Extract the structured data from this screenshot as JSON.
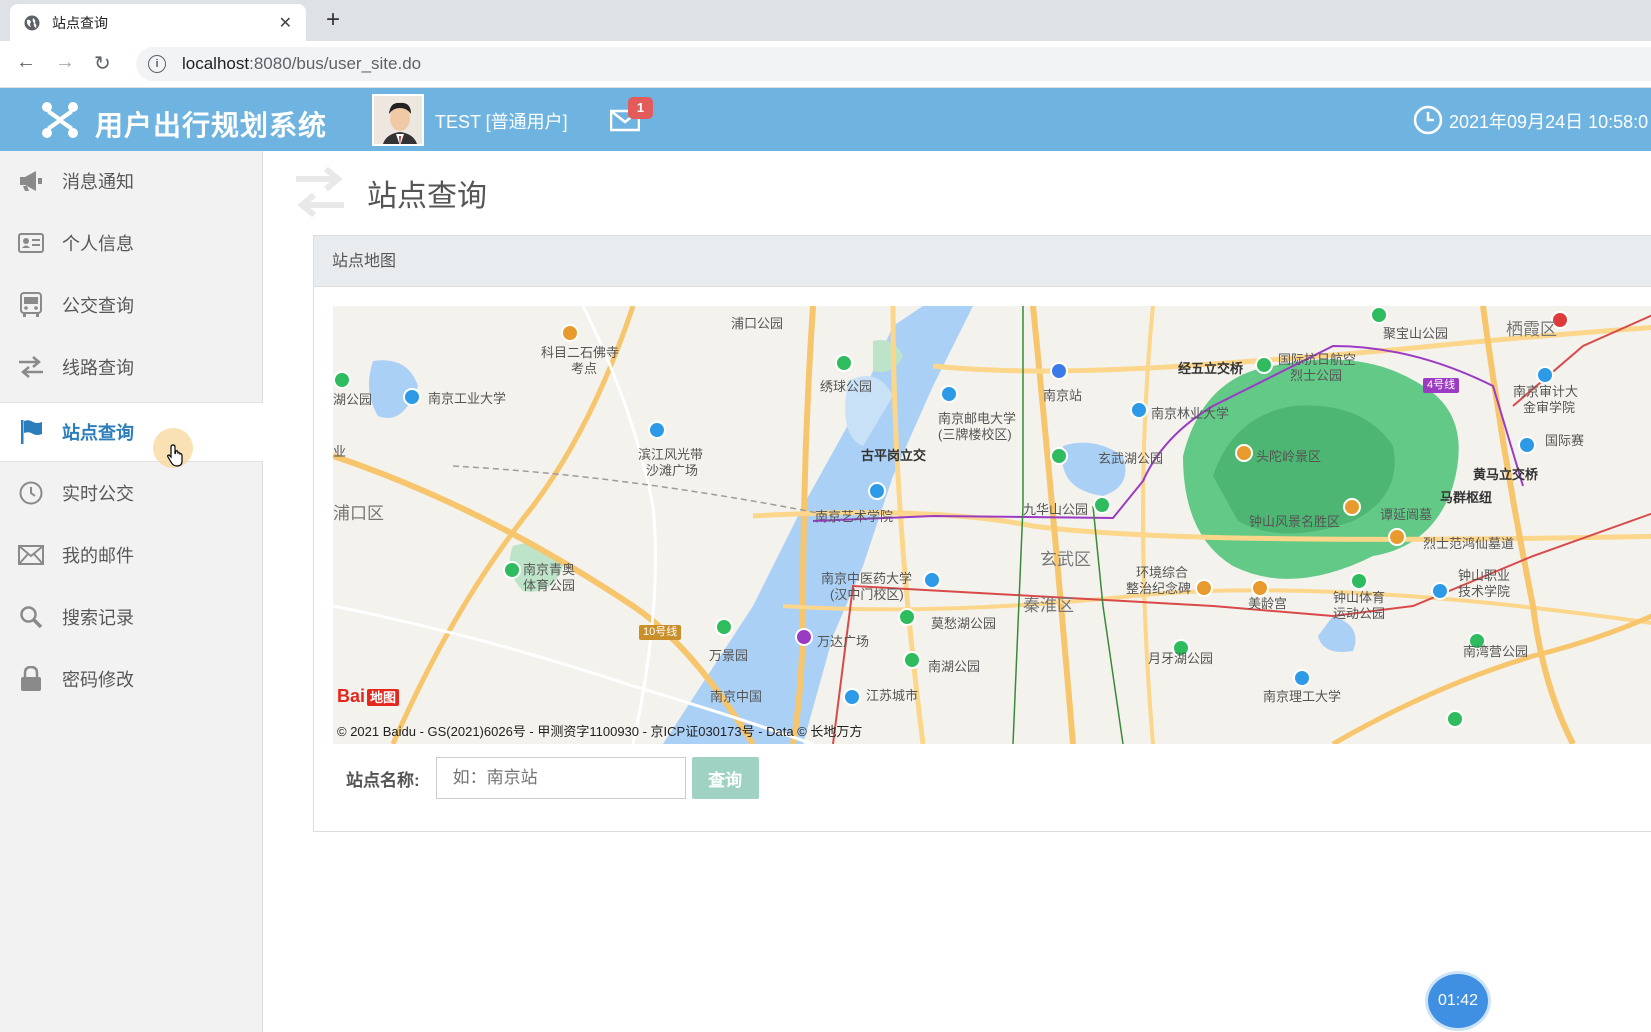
{
  "browser": {
    "tab_title": "站点查询",
    "url_host": "localhost",
    "url_rest": ":8080/bus/user_site.do"
  },
  "header": {
    "app_title": "用户出行规划系统",
    "user": "TEST [普通用户]",
    "mail_count": "1",
    "datetime": "2021年09月24日 10:58:0"
  },
  "sidebar": {
    "items": [
      {
        "label": "消息通知",
        "icon": "megaphone-icon"
      },
      {
        "label": "个人信息",
        "icon": "id-card-icon"
      },
      {
        "label": "公交查询",
        "icon": "bus-icon"
      },
      {
        "label": "线路查询",
        "icon": "exchange-icon"
      },
      {
        "label": "站点查询",
        "icon": "flag-icon"
      },
      {
        "label": "实时公交",
        "icon": "clock-icon"
      },
      {
        "label": "我的邮件",
        "icon": "envelope-icon"
      },
      {
        "label": "搜索记录",
        "icon": "search-icon"
      },
      {
        "label": "密码修改",
        "icon": "lock-icon"
      }
    ],
    "active_index": 4
  },
  "main": {
    "page_title": "站点查询",
    "panel_title": "站点地图",
    "form": {
      "label": "站点名称:",
      "placeholder": "如：南京站",
      "button": "查询"
    }
  },
  "map": {
    "copyright": "© 2021 Baidu - GS(2021)6026号 - 甲测资字1100930 - 京ICP证030173号 - Data © 长地万方",
    "brand_a": "Bai",
    "brand_b": "地图",
    "labels": {
      "l1": "浦口公园",
      "l2": "科目二石佛寺",
      "l2b": "考点",
      "l3": "南京工业大学",
      "l4": "湖公园",
      "l5": "滨江风光带",
      "l5b": "沙滩广场",
      "l6": "绣球公园",
      "l7": "南京邮电大学",
      "l7b": "(三牌楼校区)",
      "l8": "古平岗立交",
      "l9": "南京站",
      "l10": "玄武湖公园",
      "l11": "南京林业大学",
      "l12": "经五立交桥",
      "l13": "国际抗日航空",
      "l13b": "烈士公园",
      "l14": "聚宝山公园",
      "l15": "栖霞区",
      "l16": "头陀岭景区",
      "l17": "钟山风景名胜区",
      "l18": "九华山公园",
      "l19": "南京艺术学院",
      "l20": "浦口区",
      "l21": "南京青奥",
      "l21b": "体育公园",
      "l22": "南京中医药大学",
      "l22b": "(汉中门校区)",
      "l23": "玄武区",
      "l24": "秦淮区",
      "l25": "莫愁湖公园",
      "l26": "万达广场",
      "l27": "万景园",
      "l28": "南湖公园",
      "l29": "南京中国",
      "l30": "江苏城市",
      "l31": "环境综合",
      "l31b": "整治纪念碑",
      "l32": "美龄宫",
      "l33": "钟山体育",
      "l33b": "运动公园",
      "l34": "月牙湖公园",
      "l35": "南京理工大学",
      "l36": "南湾营公园",
      "l37": "钟山职业",
      "l37b": "技术学院",
      "l38": "烈士范鸿仙墓道",
      "l39": "谭延闿墓",
      "l40": "马群枢纽",
      "l41": "黄马立交桥",
      "l42": "南京审计大",
      "l42b": "金审学院",
      "l43": "国际赛",
      "l44": "10号线",
      "l45": "4号线",
      "l46": "业"
    }
  },
  "timer": "01:42"
}
